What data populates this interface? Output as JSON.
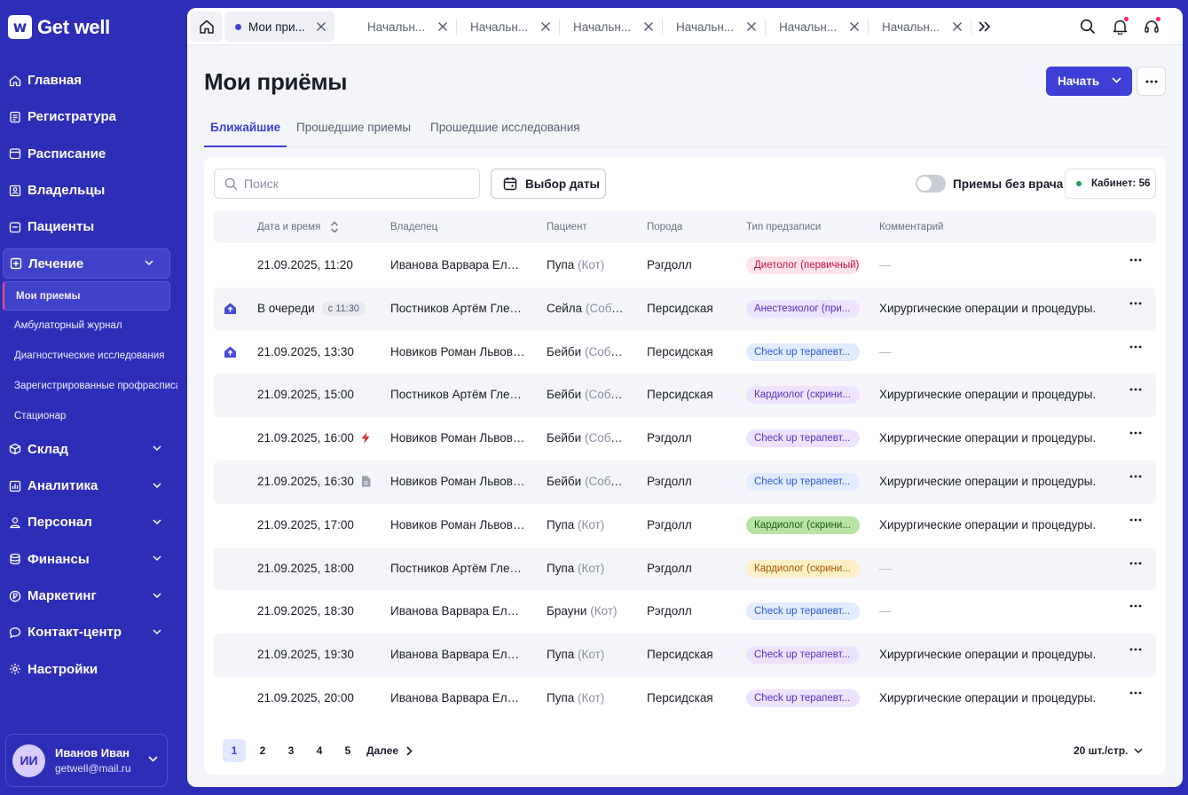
{
  "brand": {
    "mark": "w",
    "name": "Get well"
  },
  "sidebar": {
    "items": [
      {
        "label": "Главная",
        "icon": "home-icon"
      },
      {
        "label": "Регистратура",
        "icon": "document-icon"
      },
      {
        "label": "Расписание",
        "icon": "calendar-icon"
      },
      {
        "label": "Владельцы",
        "icon": "contacts-icon"
      },
      {
        "label": "Пациенты",
        "icon": "users-icon"
      },
      {
        "label": "Лечение",
        "icon": "plus-square-icon",
        "expanded": true
      },
      {
        "label": "Склад",
        "icon": "box-icon"
      },
      {
        "label": "Аналитика",
        "icon": "chart-icon"
      },
      {
        "label": "Персонал",
        "icon": "person-icon"
      },
      {
        "label": "Финансы",
        "icon": "database-icon"
      },
      {
        "label": "Маркетинг",
        "icon": "ruble-icon"
      },
      {
        "label": "Контакт-центр",
        "icon": "chat-icon"
      },
      {
        "label": "Настройки",
        "icon": "gear-icon"
      }
    ],
    "sub_items": [
      "Мои приемы",
      "Амбулаторный журнал",
      "Диагностические исследования",
      "Зарегистрированные профрасписания",
      "Стационар"
    ]
  },
  "user": {
    "initials": "ИИ",
    "name": "Иванов Иван",
    "email": "getwell@mail.ru"
  },
  "tabs": [
    {
      "label": "Мои при...",
      "active": true
    },
    {
      "label": "Начальн..."
    },
    {
      "label": "Начальн..."
    },
    {
      "label": "Начальн..."
    },
    {
      "label": "Начальн..."
    },
    {
      "label": "Начальн..."
    },
    {
      "label": "Начальн..."
    }
  ],
  "page": {
    "title": "Мои приёмы",
    "start_label": "Начать",
    "subtabs": [
      "Ближайшие",
      "Прошедшие приемы",
      "Прошедшие исследования"
    ]
  },
  "filters": {
    "search_placeholder": "Поиск",
    "date_button": "Выбор даты",
    "toggle_label": "Приемы без врача",
    "cabinet": "Кабинет: 56"
  },
  "table": {
    "columns": [
      "Дата и время",
      "Владелец",
      "Пациент",
      "Порода",
      "Тип предзаписи",
      "Комментарий"
    ],
    "rows": [
      {
        "date": "21.09.2025, 11:20",
        "owner": "Иванова Варвара Елисеевна",
        "patient": "Пупа",
        "species": "(Кот)",
        "breed": "Рэгдолл",
        "type": "Диетолог (первичный)",
        "type_bg": "#ffe4ea",
        "type_fg": "#c4123e",
        "comment": "—"
      },
      {
        "date": "В очереди",
        "queue": "с 11:30",
        "icon": "home-upload-icon",
        "owner": "Постников Артём Глебович",
        "patient": "Сейла",
        "species": "(Собака)",
        "breed": "Персидская",
        "type": "Анестезиолог (при...",
        "type_bg": "#ece3ff",
        "type_fg": "#5a2fc2",
        "comment": "Хирургические операции и процедуры."
      },
      {
        "date": "21.09.2025, 13:30",
        "icon": "home-upload-icon",
        "owner": "Новиков Роман Львович",
        "patient": "Бейби",
        "species": "(Собака)",
        "breed": "Персидская",
        "type": "Check up терапевт...",
        "type_bg": "#e2ebff",
        "type_fg": "#2c5bd6",
        "comment": "—"
      },
      {
        "date": "21.09.2025, 15:00",
        "owner": "Постников Артём Глебович",
        "patient": "Бейби",
        "species": "(Собака)",
        "breed": "Персидская",
        "type": "Кардиолог (скрини...",
        "type_bg": "#ece3ff",
        "type_fg": "#5a2fc2",
        "comment": "Хирургические операции и процедуры."
      },
      {
        "date": "21.09.2025, 16:00",
        "after_icon": "lightning-icon",
        "owner": "Новиков Роман Львович",
        "patient": "Бейби",
        "species": "(Собака)",
        "breed": "Рэгдолл",
        "type": "Check up терапевт...",
        "type_bg": "#ece3ff",
        "type_fg": "#5a2fc2",
        "comment": "Хирургические операции и процедуры."
      },
      {
        "date": "21.09.2025, 16:30",
        "after_icon": "file-icon",
        "owner": "Новиков Роман Львович",
        "patient": "Бейби",
        "species": "(Собака)",
        "breed": "Рэгдолл",
        "type": "Check up терапевт...",
        "type_bg": "#e2ebff",
        "type_fg": "#2c5bd6",
        "comment": "Хирургические операции и процедуры."
      },
      {
        "date": "21.09.2025, 17:00",
        "owner": "Новиков Роман Львович",
        "patient": "Пупа",
        "species": "(Кот)",
        "breed": "Рэгдолл",
        "type": "Кардиолог (скрини...",
        "type_bg": "#b7e4a4",
        "type_fg": "#1f5c12",
        "comment": "Хирургические операции и процедуры."
      },
      {
        "date": "21.09.2025, 18:00",
        "owner": "Постников Артём Глебович",
        "patient": "Пупа",
        "species": "(Кот)",
        "breed": "Рэгдолл",
        "type": "Кардиолог (скрини...",
        "type_bg": "#ffefc7",
        "type_fg": "#a05a00",
        "comment": "—"
      },
      {
        "date": "21.09.2025, 18:30",
        "owner": "Иванова Варвара Елисеевна",
        "patient": "Брауни",
        "species": "(Кот)",
        "breed": "Рэгдолл",
        "type": "Check up терапевт...",
        "type_bg": "#e2ebff",
        "type_fg": "#2c5bd6",
        "comment": "—"
      },
      {
        "date": "21.09.2025, 19:30",
        "owner": "Иванова Варвара Елисеевна",
        "patient": "Пупа",
        "species": "(Кот)",
        "breed": "Персидская",
        "type": "Check up терапевт...",
        "type_bg": "#ece3ff",
        "type_fg": "#5a2fc2",
        "comment": "Хирургические операции и процедуры."
      },
      {
        "date": "21.09.2025, 20:00",
        "owner": "Иванова Варвара Елисеевна",
        "patient": "Пупа",
        "species": "(Кот)",
        "breed": "Персидская",
        "type": "Check up терапевт...",
        "type_bg": "#ece3ff",
        "type_fg": "#5a2fc2",
        "comment": "Хирургические операции и процедуры."
      }
    ]
  },
  "pagination": {
    "pages": [
      "1",
      "2",
      "3",
      "4",
      "5"
    ],
    "current": "1",
    "next_label": "Далее",
    "per_page": "20 шт./стр."
  },
  "colors": {
    "sidebar": "#2d2eb8",
    "accent": "#3d3fd6",
    "notification": "#ff1f5a"
  }
}
